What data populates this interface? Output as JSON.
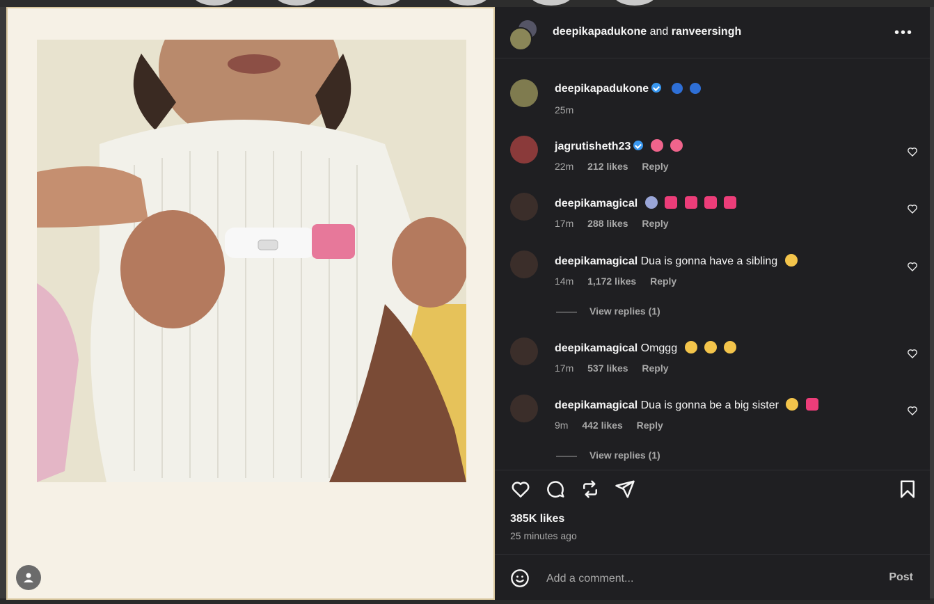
{
  "header": {
    "user1": "deepikapadukone",
    "joiner": "and",
    "user2": "ranveersingh",
    "more": "•••"
  },
  "caption": {
    "user": "deepikapadukone",
    "time": "25m"
  },
  "comments": [
    {
      "user": "jagrutisheth23",
      "text": "",
      "time": "22m",
      "likes": "212 likes",
      "reply": "Reply"
    },
    {
      "user": "deepikamagical",
      "text": "",
      "time": "17m",
      "likes": "288 likes",
      "reply": "Reply"
    },
    {
      "user": "deepikamagical",
      "text": "Dua is gonna have a sibling",
      "time": "14m",
      "likes": "1,172 likes",
      "reply": "Reply",
      "view_replies": "View replies (1)"
    },
    {
      "user": "deepikamagical",
      "text": "Omggg",
      "time": "17m",
      "likes": "537 likes",
      "reply": "Reply"
    },
    {
      "user": "deepikamagical",
      "text": "Dua is gonna be a big sister",
      "time": "9m",
      "likes": "442 likes",
      "reply": "Reply",
      "view_replies": "View replies (1)"
    }
  ],
  "post": {
    "likes": "385K likes",
    "time_ago": "25 minutes ago"
  },
  "composer": {
    "placeholder": "Add a comment...",
    "post_label": "Post"
  },
  "colors": {
    "panel_bg": "#1f1f22",
    "verified": "#3897f0",
    "muted": "#a8a8a8"
  }
}
